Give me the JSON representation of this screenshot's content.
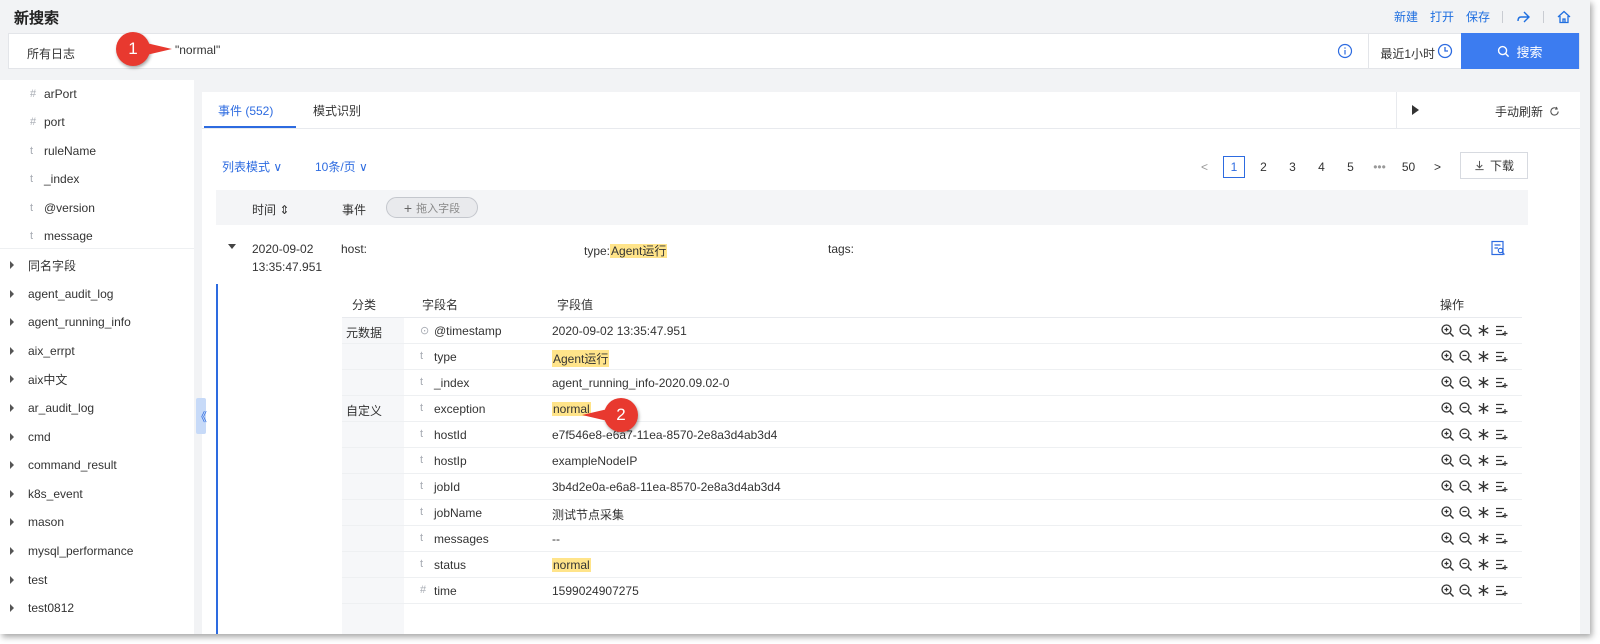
{
  "header": {
    "title": "新搜索",
    "actions": [
      "新建",
      "打开",
      "保存"
    ],
    "share_icon": "share-icon",
    "home_icon": "home-icon"
  },
  "search": {
    "scope": "所有日志",
    "query": "\"normal\"",
    "time_range": "最近1小时",
    "button_label": "搜索"
  },
  "callouts": [
    "1",
    "2"
  ],
  "sidebar": {
    "fields": [
      {
        "type": "#",
        "name": "arPort"
      },
      {
        "type": "#",
        "name": "port"
      },
      {
        "type": "t",
        "name": "ruleName"
      },
      {
        "type": "t",
        "name": "_index"
      },
      {
        "type": "t",
        "name": "@version"
      },
      {
        "type": "t",
        "name": "message"
      }
    ],
    "groups": [
      "同名字段",
      "agent_audit_log",
      "agent_running_info",
      "aix_errpt",
      "aix中文",
      "ar_audit_log",
      "cmd",
      "command_result",
      "k8s_event",
      "mason",
      "mysql_performance",
      "test",
      "test0812"
    ],
    "collapse_label": "《"
  },
  "tabs": [
    {
      "label": "事件 (552)",
      "active": true
    },
    {
      "label": "模式识别",
      "active": false
    }
  ],
  "toolbar": {
    "refresh_label": "手动刷新",
    "mode_label": "列表模式 ∨",
    "page_size_label": "10条/页 ∨",
    "download_label": "下载"
  },
  "pagination": {
    "prev": "<",
    "pages": [
      "1",
      "2",
      "3",
      "4",
      "5"
    ],
    "ellipsis": "•••",
    "last": "50",
    "next": ">",
    "current": "1"
  },
  "table": {
    "headers": {
      "time": "时间 ⇕",
      "event": "事件",
      "add_field": "拖入字段"
    }
  },
  "event": {
    "date": "2020-09-02",
    "time": "13:35:47.951",
    "host_key": "host:",
    "type_key": "type:",
    "type_value": "Agent运行",
    "tags_key": "tags:"
  },
  "detail": {
    "headers": {
      "category": "分类",
      "field": "字段名",
      "value": "字段值",
      "ops": "操作"
    },
    "rows": [
      {
        "category": "元数据",
        "type": "⊙",
        "name": "@timestamp",
        "value": "2020-09-02 13:35:47.951",
        "highlight": false
      },
      {
        "category": "",
        "type": "t",
        "name": "type",
        "value": "Agent运行",
        "highlight": true
      },
      {
        "category": "",
        "type": "t",
        "name": "_index",
        "value": "agent_running_info-2020.09.02-0",
        "highlight": false
      },
      {
        "category": "自定义",
        "type": "t",
        "name": "exception",
        "value": "normal",
        "highlight": true
      },
      {
        "category": "",
        "type": "t",
        "name": "hostId",
        "value": "e7f546e8-e6a7-11ea-8570-2e8a3d4ab3d4",
        "highlight": false
      },
      {
        "category": "",
        "type": "t",
        "name": "hostIp",
        "value": "exampleNodeIP",
        "highlight": false
      },
      {
        "category": "",
        "type": "t",
        "name": "jobId",
        "value": "3b4d2e0a-e6a8-11ea-8570-2e8a3d4ab3d4",
        "highlight": false
      },
      {
        "category": "",
        "type": "t",
        "name": "jobName",
        "value": "测试节点采集",
        "highlight": false
      },
      {
        "category": "",
        "type": "t",
        "name": "messages",
        "value": "--",
        "highlight": false
      },
      {
        "category": "",
        "type": "t",
        "name": "status",
        "value": "normal",
        "highlight": true
      },
      {
        "category": "",
        "type": "#",
        "name": "time",
        "value": "1599024907275",
        "highlight": false
      }
    ]
  },
  "colors": {
    "accent": "#2d6be0",
    "search_button": "#3c7cf0",
    "highlight": "#ffe48a",
    "callout": "#e8392f"
  }
}
